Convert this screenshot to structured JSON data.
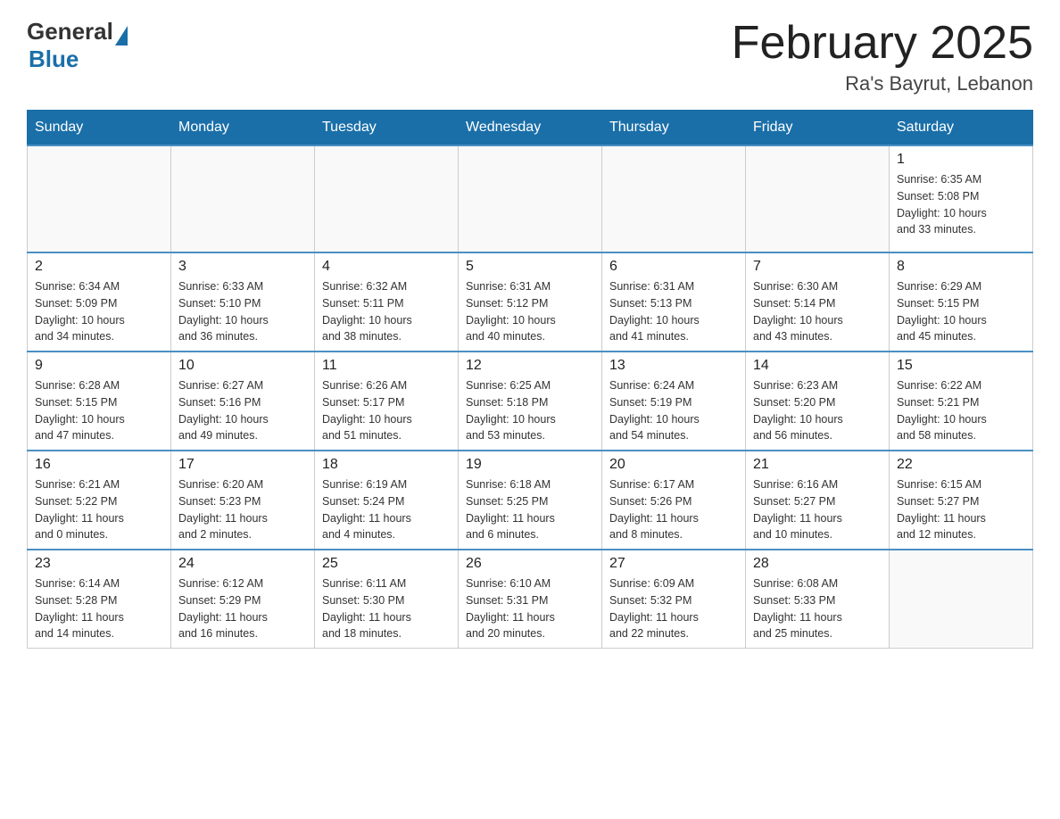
{
  "header": {
    "logo_general": "General",
    "logo_blue": "Blue",
    "title": "February 2025",
    "subtitle": "Ra's Bayrut, Lebanon"
  },
  "days_of_week": [
    "Sunday",
    "Monday",
    "Tuesday",
    "Wednesday",
    "Thursday",
    "Friday",
    "Saturday"
  ],
  "weeks": [
    [
      {
        "day": "",
        "info": ""
      },
      {
        "day": "",
        "info": ""
      },
      {
        "day": "",
        "info": ""
      },
      {
        "day": "",
        "info": ""
      },
      {
        "day": "",
        "info": ""
      },
      {
        "day": "",
        "info": ""
      },
      {
        "day": "1",
        "info": "Sunrise: 6:35 AM\nSunset: 5:08 PM\nDaylight: 10 hours\nand 33 minutes."
      }
    ],
    [
      {
        "day": "2",
        "info": "Sunrise: 6:34 AM\nSunset: 5:09 PM\nDaylight: 10 hours\nand 34 minutes."
      },
      {
        "day": "3",
        "info": "Sunrise: 6:33 AM\nSunset: 5:10 PM\nDaylight: 10 hours\nand 36 minutes."
      },
      {
        "day": "4",
        "info": "Sunrise: 6:32 AM\nSunset: 5:11 PM\nDaylight: 10 hours\nand 38 minutes."
      },
      {
        "day": "5",
        "info": "Sunrise: 6:31 AM\nSunset: 5:12 PM\nDaylight: 10 hours\nand 40 minutes."
      },
      {
        "day": "6",
        "info": "Sunrise: 6:31 AM\nSunset: 5:13 PM\nDaylight: 10 hours\nand 41 minutes."
      },
      {
        "day": "7",
        "info": "Sunrise: 6:30 AM\nSunset: 5:14 PM\nDaylight: 10 hours\nand 43 minutes."
      },
      {
        "day": "8",
        "info": "Sunrise: 6:29 AM\nSunset: 5:15 PM\nDaylight: 10 hours\nand 45 minutes."
      }
    ],
    [
      {
        "day": "9",
        "info": "Sunrise: 6:28 AM\nSunset: 5:15 PM\nDaylight: 10 hours\nand 47 minutes."
      },
      {
        "day": "10",
        "info": "Sunrise: 6:27 AM\nSunset: 5:16 PM\nDaylight: 10 hours\nand 49 minutes."
      },
      {
        "day": "11",
        "info": "Sunrise: 6:26 AM\nSunset: 5:17 PM\nDaylight: 10 hours\nand 51 minutes."
      },
      {
        "day": "12",
        "info": "Sunrise: 6:25 AM\nSunset: 5:18 PM\nDaylight: 10 hours\nand 53 minutes."
      },
      {
        "day": "13",
        "info": "Sunrise: 6:24 AM\nSunset: 5:19 PM\nDaylight: 10 hours\nand 54 minutes."
      },
      {
        "day": "14",
        "info": "Sunrise: 6:23 AM\nSunset: 5:20 PM\nDaylight: 10 hours\nand 56 minutes."
      },
      {
        "day": "15",
        "info": "Sunrise: 6:22 AM\nSunset: 5:21 PM\nDaylight: 10 hours\nand 58 minutes."
      }
    ],
    [
      {
        "day": "16",
        "info": "Sunrise: 6:21 AM\nSunset: 5:22 PM\nDaylight: 11 hours\nand 0 minutes."
      },
      {
        "day": "17",
        "info": "Sunrise: 6:20 AM\nSunset: 5:23 PM\nDaylight: 11 hours\nand 2 minutes."
      },
      {
        "day": "18",
        "info": "Sunrise: 6:19 AM\nSunset: 5:24 PM\nDaylight: 11 hours\nand 4 minutes."
      },
      {
        "day": "19",
        "info": "Sunrise: 6:18 AM\nSunset: 5:25 PM\nDaylight: 11 hours\nand 6 minutes."
      },
      {
        "day": "20",
        "info": "Sunrise: 6:17 AM\nSunset: 5:26 PM\nDaylight: 11 hours\nand 8 minutes."
      },
      {
        "day": "21",
        "info": "Sunrise: 6:16 AM\nSunset: 5:27 PM\nDaylight: 11 hours\nand 10 minutes."
      },
      {
        "day": "22",
        "info": "Sunrise: 6:15 AM\nSunset: 5:27 PM\nDaylight: 11 hours\nand 12 minutes."
      }
    ],
    [
      {
        "day": "23",
        "info": "Sunrise: 6:14 AM\nSunset: 5:28 PM\nDaylight: 11 hours\nand 14 minutes."
      },
      {
        "day": "24",
        "info": "Sunrise: 6:12 AM\nSunset: 5:29 PM\nDaylight: 11 hours\nand 16 minutes."
      },
      {
        "day": "25",
        "info": "Sunrise: 6:11 AM\nSunset: 5:30 PM\nDaylight: 11 hours\nand 18 minutes."
      },
      {
        "day": "26",
        "info": "Sunrise: 6:10 AM\nSunset: 5:31 PM\nDaylight: 11 hours\nand 20 minutes."
      },
      {
        "day": "27",
        "info": "Sunrise: 6:09 AM\nSunset: 5:32 PM\nDaylight: 11 hours\nand 22 minutes."
      },
      {
        "day": "28",
        "info": "Sunrise: 6:08 AM\nSunset: 5:33 PM\nDaylight: 11 hours\nand 25 minutes."
      },
      {
        "day": "",
        "info": ""
      }
    ]
  ]
}
